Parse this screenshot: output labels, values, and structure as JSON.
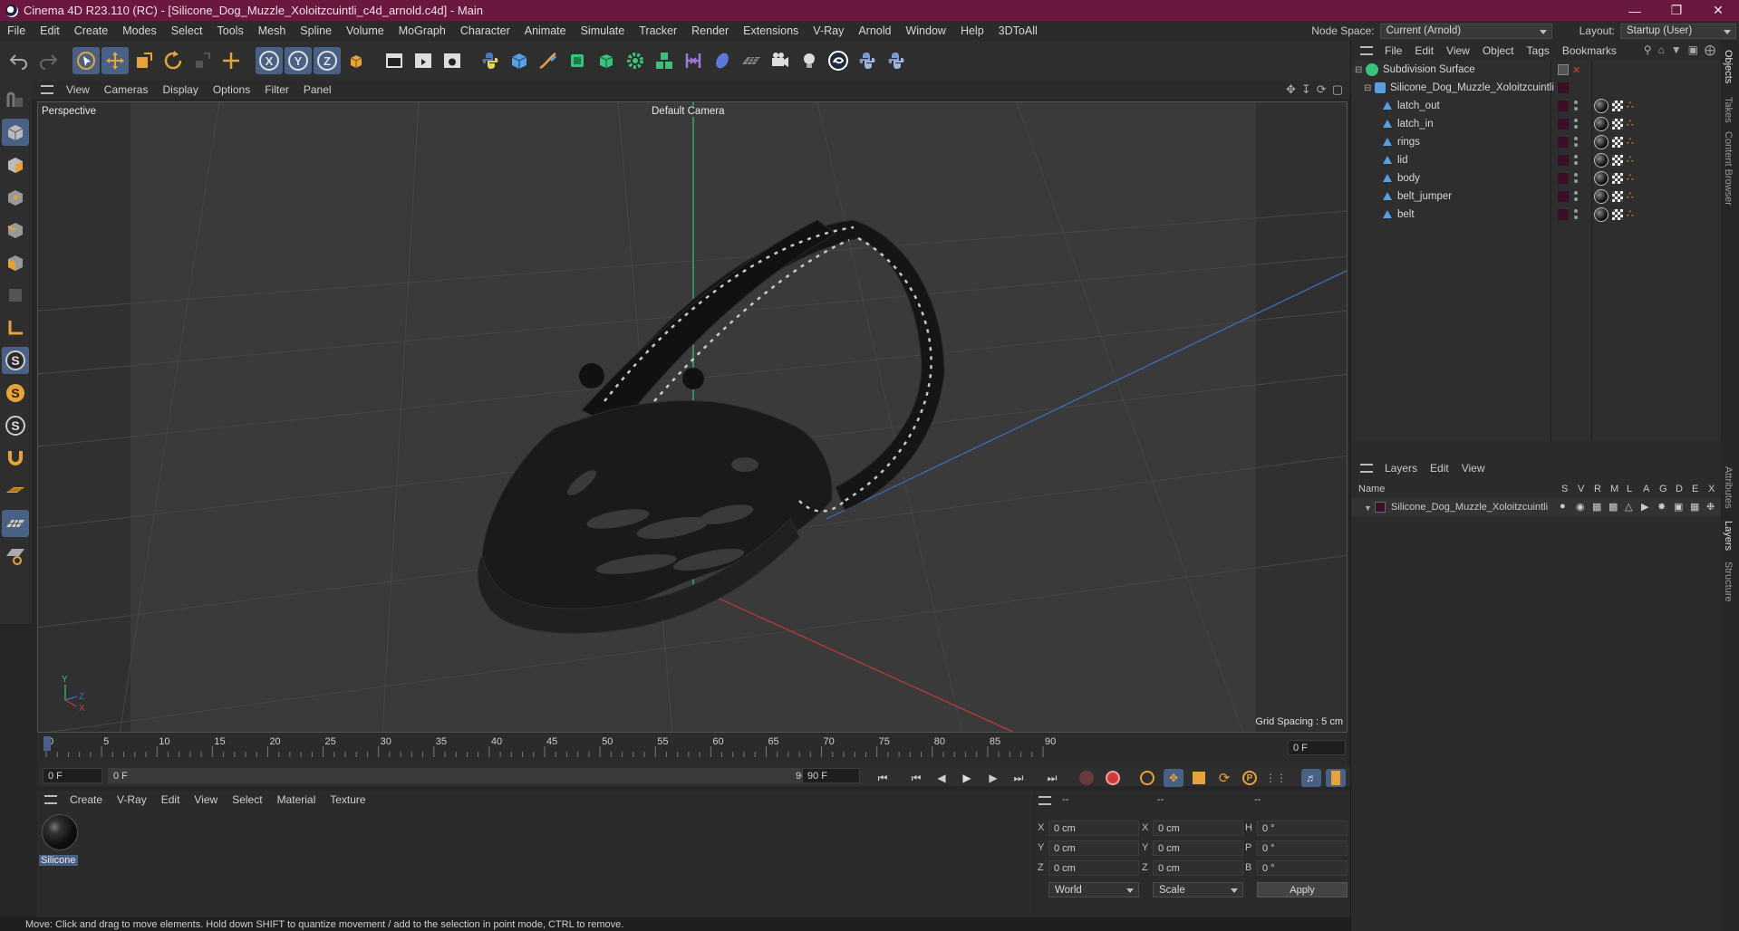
{
  "window": {
    "title": "Cinema 4D R23.110 (RC) - [Silicone_Dog_Muzzle_Xoloitzcuintli_c4d_arnold.c4d] - Main"
  },
  "menubar": {
    "items": [
      "File",
      "Edit",
      "Create",
      "Modes",
      "Select",
      "Tools",
      "Mesh",
      "Spline",
      "Volume",
      "MoGraph",
      "Character",
      "Animate",
      "Simulate",
      "Tracker",
      "Render",
      "Extensions",
      "V-Ray",
      "Arnold",
      "Window",
      "Help",
      "3DToAll"
    ],
    "node_space_label": "Node Space:",
    "node_space_value": "Current (Arnold)",
    "layout_label": "Layout:",
    "layout_value": "Startup (User)"
  },
  "toolbar": {
    "axis_x": "X",
    "axis_y": "Y",
    "axis_z": "Z"
  },
  "viewport_menu": {
    "items": [
      "View",
      "Cameras",
      "Display",
      "Options",
      "Filter",
      "Panel"
    ]
  },
  "viewport": {
    "label": "Perspective",
    "camera": "Default Camera",
    "grid_spacing": "Grid Spacing : 5 cm",
    "axis_y": "Y",
    "axis_z": "Z",
    "axis_x": "X"
  },
  "timeline": {
    "ticks": [
      "0",
      "5",
      "10",
      "15",
      "20",
      "25",
      "30",
      "35",
      "40",
      "45",
      "50",
      "55",
      "60",
      "65",
      "70",
      "75",
      "80",
      "85",
      "90"
    ],
    "current_frame": "0 F"
  },
  "playback": {
    "start": "0 F",
    "range_start": "0 F",
    "range_end": "90 F",
    "end": "90 F"
  },
  "material_panel": {
    "menu": [
      "Create",
      "V-Ray",
      "Edit",
      "View",
      "Select",
      "Material",
      "Texture"
    ],
    "material_name": "Silicone"
  },
  "coord_panel": {
    "headers": [
      "--",
      "--",
      "--"
    ],
    "rows": [
      {
        "a": "X",
        "av": "0 cm",
        "b": "X",
        "bv": "0 cm",
        "c": "H",
        "cv": "0 °"
      },
      {
        "a": "Y",
        "av": "0 cm",
        "b": "Y",
        "bv": "0 cm",
        "c": "P",
        "cv": "0 °"
      },
      {
        "a": "Z",
        "av": "0 cm",
        "b": "Z",
        "bv": "0 cm",
        "c": "B",
        "cv": "0 °"
      }
    ],
    "world": "World",
    "scale": "Scale",
    "apply": "Apply"
  },
  "status": {
    "text": "Move: Click and drag to move elements. Hold down SHIFT to quantize movement / add to the selection in point mode, CTRL to remove."
  },
  "objects_panel": {
    "menu": [
      "File",
      "Edit",
      "View",
      "Object",
      "Tags",
      "Bookmarks"
    ],
    "root": "Subdivision Surface",
    "group": "Silicone_Dog_Muzzle_Xoloitzcuintli",
    "children": [
      "latch_out",
      "latch_in",
      "rings",
      "lid",
      "body",
      "belt_jumper",
      "belt"
    ]
  },
  "layers_panel": {
    "menu": [
      "Layers",
      "Edit",
      "View"
    ],
    "col_name": "Name",
    "cols": [
      "S",
      "V",
      "R",
      "M",
      "L",
      "A",
      "G",
      "D",
      "E",
      "X"
    ],
    "layer_name": "Silicone_Dog_Muzzle_Xoloitzcuintli"
  },
  "side_tabs": [
    "Objects",
    "Takes",
    "Content Browser",
    "Attributes",
    "Layers",
    "Structure"
  ],
  "colors": {
    "accent": "#496184",
    "title_bar": "#6b1840",
    "layer_color": "#3a0f2a"
  }
}
